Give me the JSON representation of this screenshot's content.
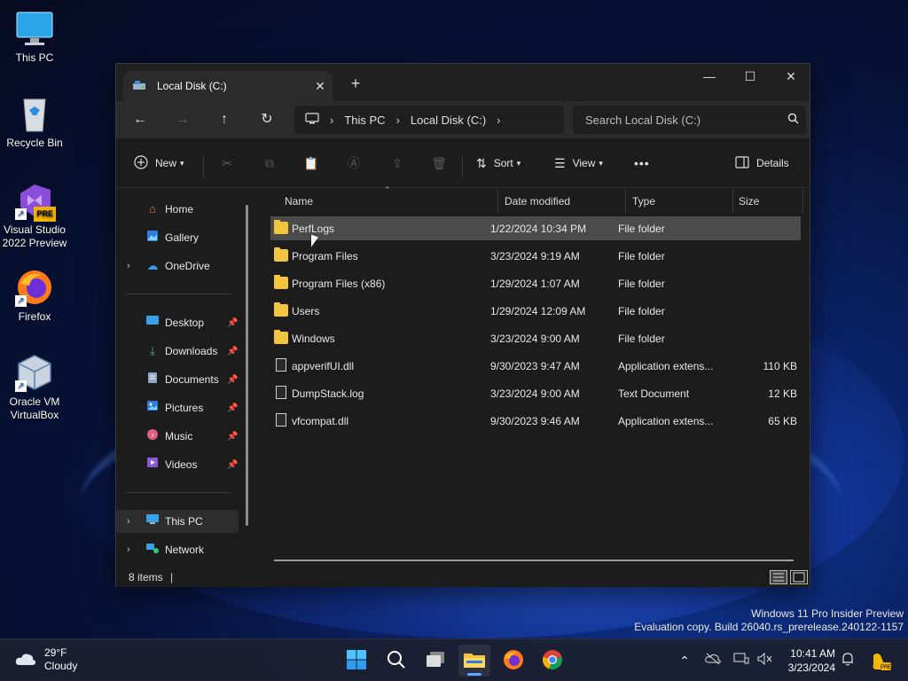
{
  "colors": {
    "accent": "#60a5ff",
    "folder": "#f3c440",
    "selected_row": "#4b4b4b",
    "window_bg": "#1c1c1c"
  },
  "desktop": {
    "icons": [
      {
        "label": "This PC",
        "icon": "monitor-icon"
      },
      {
        "label": "Recycle Bin",
        "icon": "recycle-bin-icon"
      },
      {
        "label": "Visual Studio 2022 Preview",
        "icon": "visual-studio-icon",
        "badge": "PRE"
      },
      {
        "label": "Firefox",
        "icon": "firefox-icon"
      },
      {
        "label": "Oracle VM VirtualBox",
        "icon": "virtualbox-icon"
      }
    ]
  },
  "window": {
    "tab_title": "Local Disk (C:)",
    "new_tab": "+",
    "controls": {
      "minimize": "—",
      "maximize": "☐",
      "close": "✕"
    }
  },
  "address": {
    "crumbs": [
      "This PC",
      "Local Disk (C:)"
    ],
    "search_placeholder": "Search Local Disk (C:)"
  },
  "toolbar": {
    "new_label": "New",
    "sort_label": "Sort",
    "view_label": "View",
    "more_label": "•••",
    "details_label": "Details"
  },
  "nav": {
    "top": [
      {
        "label": "Home",
        "icon": "home-icon"
      },
      {
        "label": "Gallery",
        "icon": "gallery-icon"
      },
      {
        "label": "OneDrive",
        "icon": "onedrive-icon",
        "expandable": true
      }
    ],
    "quick": [
      {
        "label": "Desktop",
        "icon": "desktop-icon",
        "pinned": true
      },
      {
        "label": "Downloads",
        "icon": "downloads-icon",
        "pinned": true
      },
      {
        "label": "Documents",
        "icon": "documents-icon",
        "pinned": true
      },
      {
        "label": "Pictures",
        "icon": "pictures-icon",
        "pinned": true
      },
      {
        "label": "Music",
        "icon": "music-icon",
        "pinned": true
      },
      {
        "label": "Videos",
        "icon": "videos-icon",
        "pinned": true
      }
    ],
    "bottom": [
      {
        "label": "This PC",
        "icon": "this-pc-icon",
        "expandable": true,
        "selected": true
      },
      {
        "label": "Network",
        "icon": "network-icon",
        "expandable": true
      }
    ]
  },
  "files": {
    "columns": [
      "Name",
      "Date modified",
      "Type",
      "Size"
    ],
    "rows": [
      {
        "name": "PerfLogs",
        "date": "1/22/2024 10:34 PM",
        "type": "File folder",
        "size": "",
        "kind": "folder",
        "selected": true
      },
      {
        "name": "Program Files",
        "date": "3/23/2024 9:19 AM",
        "type": "File folder",
        "size": "",
        "kind": "folder"
      },
      {
        "name": "Program Files (x86)",
        "date": "1/29/2024 1:07 AM",
        "type": "File folder",
        "size": "",
        "kind": "folder"
      },
      {
        "name": "Users",
        "date": "1/29/2024 12:09 AM",
        "type": "File folder",
        "size": "",
        "kind": "folder"
      },
      {
        "name": "Windows",
        "date": "3/23/2024 9:00 AM",
        "type": "File folder",
        "size": "",
        "kind": "folder"
      },
      {
        "name": "appverifUI.dll",
        "date": "9/30/2023 9:47 AM",
        "type": "Application extens...",
        "size": "110 KB",
        "kind": "file"
      },
      {
        "name": "DumpStack.log",
        "date": "3/23/2024 9:00 AM",
        "type": "Text Document",
        "size": "12 KB",
        "kind": "file"
      },
      {
        "name": "vfcompat.dll",
        "date": "9/30/2023 9:46 AM",
        "type": "Application extens...",
        "size": "65 KB",
        "kind": "file"
      }
    ]
  },
  "status": {
    "item_count": "8 items"
  },
  "watermark": {
    "line1": "Windows 11 Pro Insider Preview",
    "line2": "Evaluation copy. Build 26040.rs_prerelease.240122-1157"
  },
  "taskbar": {
    "weather_temp": "29°F",
    "weather_desc": "Cloudy",
    "time": "10:41 AM",
    "date": "3/23/2024"
  }
}
